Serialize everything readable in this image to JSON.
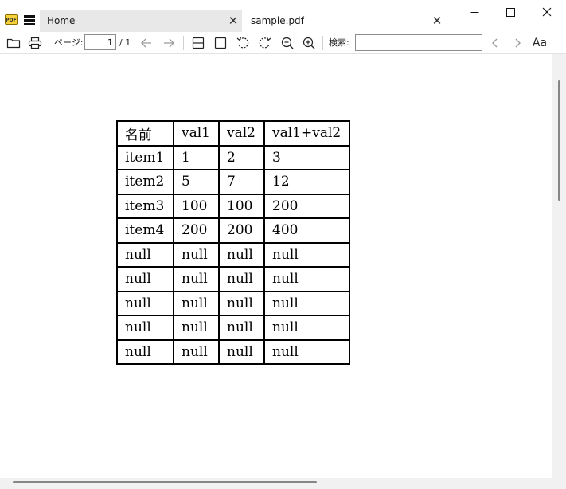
{
  "app": {
    "logo_text": "PDF"
  },
  "tabs": [
    {
      "label": "Home"
    },
    {
      "label": "sample.pdf"
    }
  ],
  "toolbar": {
    "page_label": "ページ:",
    "current_page": "1",
    "total_pages": "/ 1",
    "search_label": "検索:",
    "search_value": "",
    "text_settings_label": "Aa"
  },
  "document": {
    "table": {
      "header": [
        "名前",
        "val1",
        "val2",
        "val1+val2"
      ],
      "rows": [
        [
          "item1",
          "1",
          "2",
          "3"
        ],
        [
          "item2",
          "5",
          "7",
          "12"
        ],
        [
          "item3",
          "100",
          "100",
          "200"
        ],
        [
          "item4",
          "200",
          "200",
          "400"
        ],
        [
          "null",
          "null",
          "null",
          "null"
        ],
        [
          "null",
          "null",
          "null",
          "null"
        ],
        [
          "null",
          "null",
          "null",
          "null"
        ],
        [
          "null",
          "null",
          "null",
          "null"
        ],
        [
          "null",
          "null",
          "null",
          "null"
        ]
      ]
    }
  }
}
